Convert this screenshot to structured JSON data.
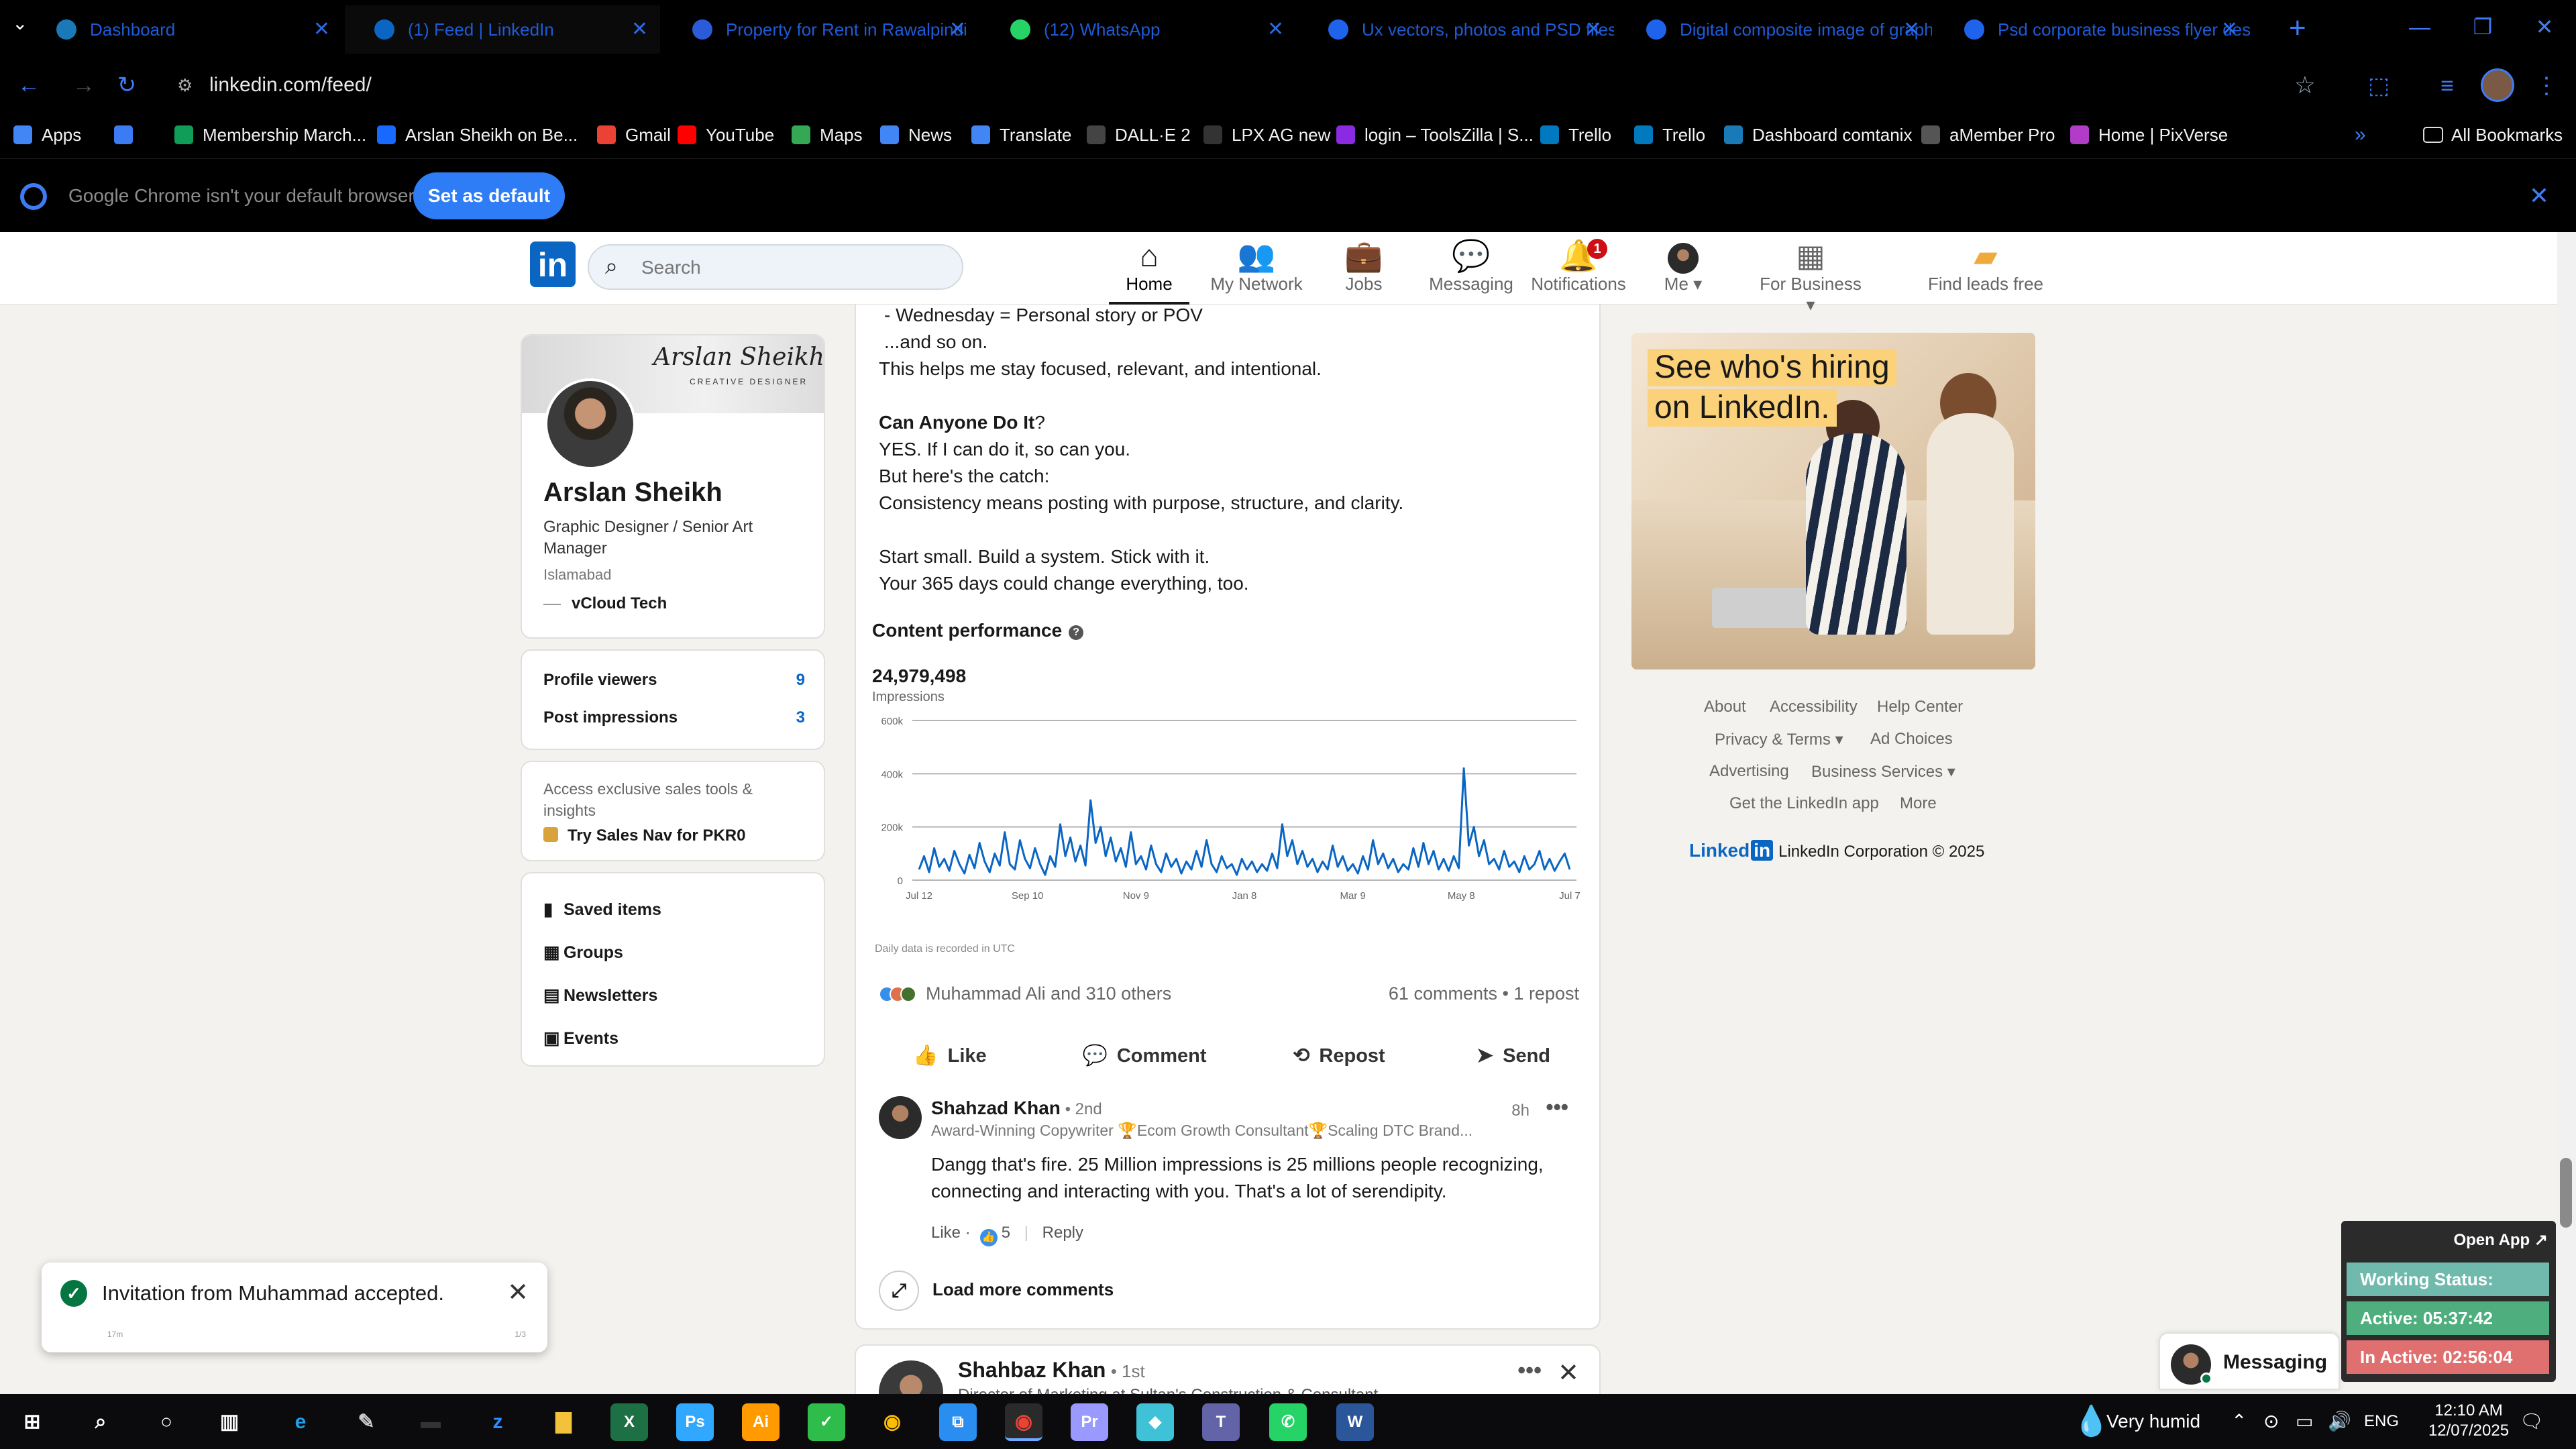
{
  "browser": {
    "tabs": [
      {
        "title": "Dashboard",
        "icon": "dashboard-favicon",
        "color": "#1a7ab8"
      },
      {
        "title": "(1) Feed | LinkedIn",
        "icon": "linkedin-favicon",
        "color": "#0a66c2"
      },
      {
        "title": "Property for Rent in Rawalpindi",
        "icon": "property-favicon",
        "color": "#2b5bd7"
      },
      {
        "title": "(12) WhatsApp",
        "icon": "whatsapp-favicon",
        "color": "#25d366"
      },
      {
        "title": "Ux vectors, photos and PSD files",
        "icon": "freepik-favicon",
        "color": "#1f63ec"
      },
      {
        "title": "Digital composite image of graph",
        "icon": "freepik-favicon",
        "color": "#1f63ec"
      },
      {
        "title": "Psd corporate business flyer design",
        "icon": "freepik-favicon",
        "color": "#1f63ec"
      }
    ],
    "url": "linkedin.com/feed/",
    "bookmarks": [
      {
        "label": "Apps",
        "color": "#4285f4"
      },
      {
        "label": "",
        "color": "#3d7bf5"
      },
      {
        "label": "Membership March...",
        "color": "#0f9d58"
      },
      {
        "label": "Arslan Sheikh on Be...",
        "color": "#1769ff"
      },
      {
        "label": "Gmail",
        "color": "#ea4335"
      },
      {
        "label": "YouTube",
        "color": "#ff0000"
      },
      {
        "label": "Maps",
        "color": "#34a853"
      },
      {
        "label": "News",
        "color": "#4285f4"
      },
      {
        "label": "Translate",
        "color": "#4285f4"
      },
      {
        "label": "DALL·E 2",
        "color": "#444444"
      },
      {
        "label": "LPX AG new",
        "color": "#333333"
      },
      {
        "label": "login – ToolsZilla | S...",
        "color": "#8a2be2"
      },
      {
        "label": "Trello",
        "color": "#0079bf"
      },
      {
        "label": "Trello",
        "color": "#0079bf"
      },
      {
        "label": "Dashboard comtanix",
        "color": "#1a7ab8"
      },
      {
        "label": "aMember Pro",
        "color": "#555555"
      },
      {
        "label": "Home | PixVerse",
        "color": "#b03cc8"
      }
    ],
    "all_bookmarks": "All Bookmarks",
    "default_bar": {
      "message": "Google Chrome isn't your default browser",
      "button": "Set as default"
    }
  },
  "linkedin": {
    "search_placeholder": "Search",
    "nav": [
      {
        "label": "Home",
        "icon": "home-icon",
        "glyph": "⌂"
      },
      {
        "label": "My Network",
        "icon": "network-icon",
        "glyph": "👥"
      },
      {
        "label": "Jobs",
        "icon": "briefcase-icon",
        "glyph": "💼"
      },
      {
        "label": "Messaging",
        "icon": "chat-icon",
        "glyph": "💬"
      },
      {
        "label": "Notifications",
        "icon": "bell-icon",
        "glyph": "🔔",
        "badge": "1"
      },
      {
        "label": "Me",
        "icon": "avatar-icon",
        "glyph": ""
      },
      {
        "label": "For Business",
        "icon": "grid-icon",
        "glyph": "▦"
      },
      {
        "label": "Find leads free",
        "icon": "leads-icon",
        "glyph": "▰"
      }
    ],
    "profile": {
      "cover_text": "Arslan Sheikh",
      "cover_sub": "CREATIVE DESIGNER",
      "name": "Arslan Sheikh",
      "title": "Graphic Designer / Senior Art Manager",
      "location": "Islamabad",
      "company": "vCloud Tech"
    },
    "stats": [
      {
        "label": "Profile viewers",
        "value": "9"
      },
      {
        "label": "Post impressions",
        "value": "3"
      }
    ],
    "sales": {
      "text": "Access exclusive sales tools & insights",
      "link": "Try Sales Nav for PKR0"
    },
    "links": [
      "Saved items",
      "Groups",
      "Newsletters",
      "Events"
    ],
    "post": {
      "lines": [
        "- Wednesday = Personal story or POV",
        "...and so on.",
        "This helps me stay focused, relevant, and intentional."
      ],
      "heading": "Can Anyone Do It",
      "heading_q": "?",
      "lines2": [
        "YES. If I can do it, so can you.",
        "But here's the catch:",
        "Consistency means posting with purpose, structure, and clarity."
      ],
      "lines3": [
        "Start small. Build a system. Stick with it.",
        "Your 365 days could change everything, too."
      ],
      "performance_title": "Content performance",
      "impressions": "24,979,498",
      "impressions_label": "Impressions",
      "chart_note": "Daily data is recorded in UTC",
      "reactions": "Muhammad Ali and 310 others",
      "counts": "61 comments • 1 repost",
      "actions": [
        {
          "label": "Like",
          "icon": "like-icon",
          "glyph": "👍"
        },
        {
          "label": "Comment",
          "icon": "comment-icon",
          "glyph": "💬"
        },
        {
          "label": "Repost",
          "icon": "repost-icon",
          "glyph": "⟲"
        },
        {
          "label": "Send",
          "icon": "send-icon",
          "glyph": "➤"
        }
      ]
    },
    "comment": {
      "name": "Shahzad Khan",
      "degree": " • 2nd",
      "headline": "Award-Winning Copywriter 🏆Ecom Growth Consultant🏆Scaling DTC Brand...",
      "time": "8h",
      "body": "Dangg that's fire. 25 Million impressions is 25 millions people recognizing, connecting and interacting with you. That's a lot of serendipity.",
      "like": "Like",
      "likes": "5",
      "reply": "Reply"
    },
    "load_more": "Load more comments",
    "next_post": {
      "name": "Shahbaz Khan",
      "degree": " • 1st",
      "sub": "Director of Marketing at Sultan's Construction & Consultant"
    },
    "ad": {
      "line1": "See who's hiring",
      "line2": "on LinkedIn."
    },
    "footer": {
      "about": "About",
      "accessibility": "Accessibility",
      "help": "Help Center",
      "privacy": "Privacy & Terms ▾",
      "adchoices": "Ad Choices",
      "advertising": "Advertising",
      "business": "Business Services ▾",
      "app": "Get the LinkedIn app",
      "more": "More",
      "brand": "Linked",
      "copyright": "LinkedIn Corporation © 2025"
    },
    "toast": {
      "text": "Invitation from Muhammad accepted.",
      "left": "17m",
      "right": "1/3"
    },
    "messaging": "Messaging"
  },
  "status_widget": {
    "open_app": "Open App ↗",
    "working": "Working Status: Active",
    "active": "Active: 05:37:42",
    "inactive": "In Active: 02:56:04"
  },
  "taskbar": {
    "weather": "Very humid",
    "lang": "ENG",
    "time": "12:10 AM",
    "date": "12/07/2025",
    "apps": [
      {
        "name": "start",
        "color": "#ffffff"
      },
      {
        "name": "search",
        "color": "#ffffff"
      },
      {
        "name": "cortana",
        "color": "#ffffff"
      },
      {
        "name": "task-view",
        "color": "#ffffff"
      },
      {
        "name": "edge",
        "color": "#1fa0e8"
      },
      {
        "name": "pen",
        "color": "#cccccc"
      },
      {
        "name": "terminal",
        "color": "#333333"
      },
      {
        "name": "zoom",
        "color": "#2d8cff"
      },
      {
        "name": "file-explorer",
        "color": "#f3c13a"
      },
      {
        "name": "excel",
        "color": "#1d7044"
      },
      {
        "name": "photoshop",
        "color": "#31a8ff"
      },
      {
        "name": "illustrator",
        "color": "#ff9a00"
      },
      {
        "name": "corel",
        "color": "#2ebd4a"
      },
      {
        "name": "chrome",
        "color": "#fbbc05"
      },
      {
        "name": "vscode",
        "color": "#2a8df0"
      },
      {
        "name": "chrome-active",
        "color": "#ea4335"
      },
      {
        "name": "premiere",
        "color": "#9999ff"
      },
      {
        "name": "app-blue",
        "color": "#3fc1d8"
      },
      {
        "name": "teams",
        "color": "#6264a7"
      },
      {
        "name": "whatsapp",
        "color": "#25d366"
      },
      {
        "name": "word",
        "color": "#2b579a"
      }
    ]
  },
  "chart_data": {
    "type": "line",
    "x_tick_labels": [
      "Jul 12",
      "Sep 10",
      "Nov 9",
      "Jan 8",
      "Mar 9",
      "May 8",
      "Jul 7"
    ],
    "y_tick_labels": [
      "0",
      "200k",
      "400k",
      "600k"
    ],
    "ylim": [
      0,
      600000
    ],
    "grid": true,
    "color": "#0a66c2",
    "values": [
      40000,
      90000,
      30000,
      120000,
      50000,
      80000,
      35000,
      110000,
      60000,
      25000,
      95000,
      45000,
      140000,
      70000,
      30000,
      100000,
      55000,
      180000,
      60000,
      40000,
      150000,
      80000,
      45000,
      120000,
      60000,
      20000,
      90000,
      50000,
      210000,
      90000,
      160000,
      70000,
      130000,
      55000,
      300000,
      140000,
      200000,
      90000,
      160000,
      70000,
      120000,
      50000,
      180000,
      60000,
      90000,
      40000,
      130000,
      60000,
      30000,
      100000,
      50000,
      80000,
      25000,
      70000,
      40000,
      110000,
      50000,
      150000,
      60000,
      30000,
      90000,
      45000,
      60000,
      20000,
      80000,
      40000,
      70000,
      30000,
      60000,
      35000,
      100000,
      45000,
      210000,
      90000,
      150000,
      60000,
      110000,
      50000,
      80000,
      30000,
      70000,
      40000,
      130000,
      50000,
      90000,
      35000,
      60000,
      25000,
      90000,
      40000,
      150000,
      60000,
      100000,
      45000,
      80000,
      30000,
      60000,
      40000,
      120000,
      50000,
      140000,
      60000,
      110000,
      40000,
      80000,
      35000,
      90000,
      45000,
      420000,
      130000,
      200000,
      90000,
      150000,
      60000,
      80000,
      40000,
      110000,
      50000,
      70000,
      30000,
      90000,
      40000,
      60000,
      110000,
      40000,
      80000,
      35000,
      70000,
      100000,
      40000
    ]
  }
}
